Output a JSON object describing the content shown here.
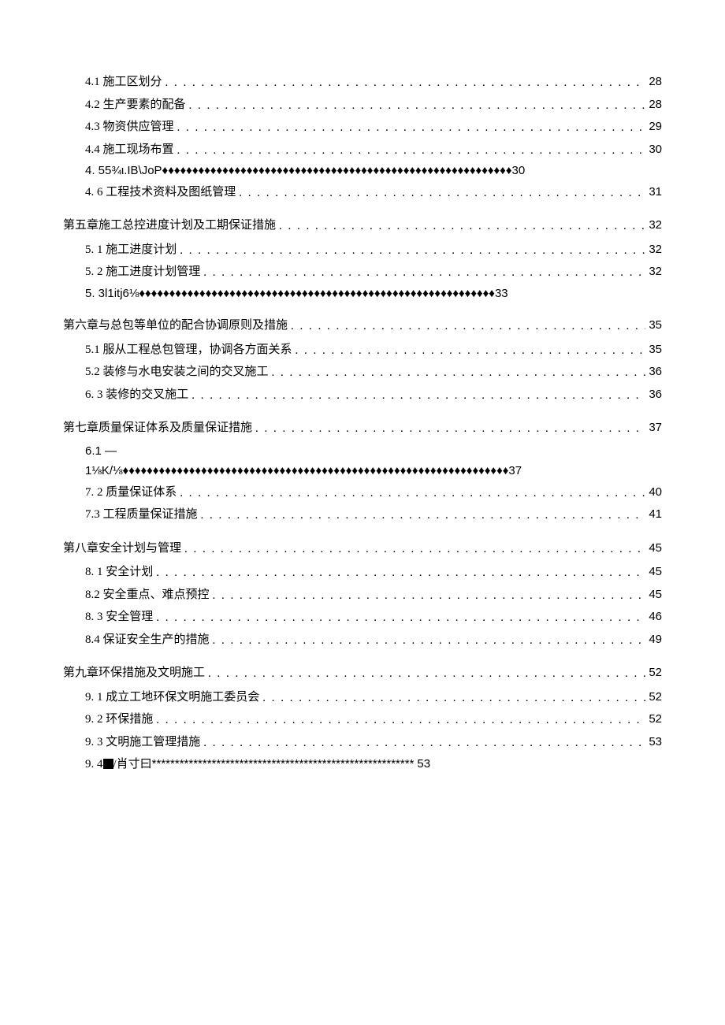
{
  "toc": [
    {
      "type": "sub",
      "number": "4.1",
      "title": "施工区划分",
      "page": "28"
    },
    {
      "type": "sub",
      "number": "4.2",
      "title": "生产要素的配备",
      "page": "28"
    },
    {
      "type": "sub",
      "number": "4.3",
      "title": "物资供应管理",
      "page": "29"
    },
    {
      "type": "sub",
      "number": "4.4",
      "title": "施工现场布置",
      "page": "30"
    },
    {
      "type": "corrupt",
      "indent": true,
      "text": "4.   55¾ι.IB\\JoP♦♦♦♦♦♦♦♦♦♦♦♦♦♦♦♦♦♦♦♦♦♦♦♦♦♦♦♦♦♦♦♦♦♦♦♦♦♦♦♦♦♦♦♦♦♦♦♦♦♦♦♦♦♦♦♦♦♦30"
    },
    {
      "type": "sub",
      "number": "4.   6",
      "title": "工程技术资料及图纸管理",
      "page": "31"
    },
    {
      "type": "chapter",
      "title": "第五章施工总控进度计划及工期保证措施",
      "page": "32"
    },
    {
      "type": "sub",
      "number": "5.   1",
      "title": "施工进度计划",
      "page": "32"
    },
    {
      "type": "sub",
      "number": "5.   2",
      "title": "施工进度计划管理",
      "page": "32"
    },
    {
      "type": "corrupt",
      "indent": true,
      "text": "5.   3l1itj6⅛♦♦♦♦♦♦♦♦♦♦♦♦♦♦♦♦♦♦♦♦♦♦♦♦♦♦♦♦♦♦♦♦♦♦♦♦♦♦♦♦♦♦♦♦♦♦♦♦♦♦♦♦♦♦♦♦♦♦♦33"
    },
    {
      "type": "chapter",
      "title": "第六章与总包等单位的配合协调原则及措施",
      "page": "35"
    },
    {
      "type": "sub",
      "number": "5.1",
      "title": "   服从工程总包管理，协调各方面关系",
      "page": "35"
    },
    {
      "type": "sub",
      "number": "5.2",
      "title": "   装修与水电安装之间的交叉施工",
      "page": "36"
    },
    {
      "type": "sub",
      "number": "6.   3",
      "title": "装修的交叉施工",
      "page": "36"
    },
    {
      "type": "chapter",
      "title": "第七章质量保证体系及质量保证措施",
      "page": "37"
    },
    {
      "type": "corrupt",
      "indent": true,
      "text": "6.1   —\n1⅛K/⅛♦♦♦♦♦♦♦♦♦♦♦♦♦♦♦♦♦♦♦♦♦♦♦♦♦♦♦♦♦♦♦♦♦♦♦♦♦♦♦♦♦♦♦♦♦♦♦♦♦♦♦♦♦♦♦♦♦♦♦♦♦♦♦♦37"
    },
    {
      "type": "sub",
      "number": "7.   2",
      "title": "质量保证体系",
      "page": "40"
    },
    {
      "type": "sub",
      "number": "7.3",
      "title": "工程质量保证措施",
      "page": "41"
    },
    {
      "type": "chapter",
      "title": "第八章安全计划与管理",
      "page": "45"
    },
    {
      "type": "sub",
      "number": "8.   1",
      "title": "安全计划",
      "page": "45"
    },
    {
      "type": "sub",
      "number": "8.2",
      "title": "安全重点、难点预控",
      "page": "45"
    },
    {
      "type": "sub",
      "number": "8.   3",
      "title": "安全管理",
      "page": "46"
    },
    {
      "type": "sub",
      "number": "8.4",
      "title": "保证安全生产的措施",
      "page": "49"
    },
    {
      "type": "chapter",
      "title": "第九章环保措施及文明施工",
      "page": "52"
    },
    {
      "type": "sub",
      "number": "9.   1",
      "title": "成立工地环保文明施工委员会",
      "page": "52"
    },
    {
      "type": "sub",
      "number": "9.   2",
      "title": "环保措施",
      "page": "52"
    },
    {
      "type": "sub",
      "number": "9.   3",
      "title": "文明施工管理措施",
      "page": "53"
    },
    {
      "type": "corrupt-sq",
      "indent": true,
      "prefix": "9.   4",
      "mid": "/肖寸曰",
      "stars": "*********************************************************",
      "page": "53"
    }
  ]
}
